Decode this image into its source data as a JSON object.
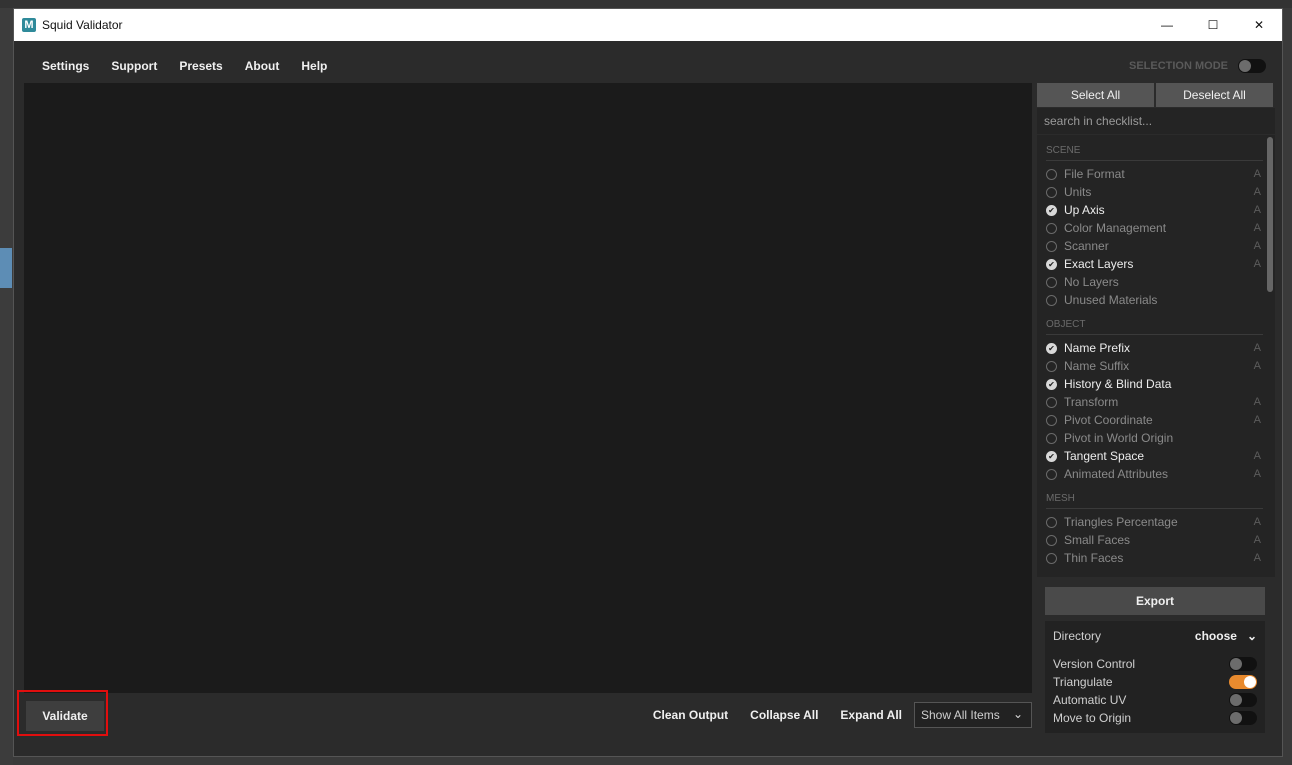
{
  "window": {
    "title": "Squid Validator",
    "icon_letter": "M"
  },
  "window_controls": {
    "minimize": "—",
    "maximize": "☐",
    "close": "✕"
  },
  "menu": {
    "items": [
      "Settings",
      "Support",
      "Presets",
      "About",
      "Help"
    ],
    "selection_mode_label": "SELECTION MODE",
    "selection_mode_on": false
  },
  "panel": {
    "select_all": "Select All",
    "deselect_all": "Deselect All",
    "search_placeholder": "search in checklist...",
    "sections": [
      {
        "title": "SCENE",
        "items": [
          {
            "label": "File Format",
            "checked": false,
            "badge": "A"
          },
          {
            "label": "Units",
            "checked": false,
            "badge": "A"
          },
          {
            "label": "Up Axis",
            "checked": true,
            "badge": "A"
          },
          {
            "label": "Color Management",
            "checked": false,
            "badge": "A"
          },
          {
            "label": "Scanner",
            "checked": false,
            "badge": "A"
          },
          {
            "label": "Exact Layers",
            "checked": true,
            "badge": "A"
          },
          {
            "label": "No Layers",
            "checked": false,
            "badge": ""
          },
          {
            "label": "Unused Materials",
            "checked": false,
            "badge": ""
          }
        ]
      },
      {
        "title": "OBJECT",
        "items": [
          {
            "label": "Name Prefix",
            "checked": true,
            "badge": "A"
          },
          {
            "label": "Name Suffix",
            "checked": false,
            "badge": "A"
          },
          {
            "label": "History & Blind Data",
            "checked": true,
            "badge": ""
          },
          {
            "label": "Transform",
            "checked": false,
            "badge": "A"
          },
          {
            "label": "Pivot Coordinate",
            "checked": false,
            "badge": "A"
          },
          {
            "label": "Pivot in World Origin",
            "checked": false,
            "badge": ""
          },
          {
            "label": "Tangent Space",
            "checked": true,
            "badge": "A"
          },
          {
            "label": "Animated Attributes",
            "checked": false,
            "badge": "A"
          }
        ]
      },
      {
        "title": "MESH",
        "items": [
          {
            "label": "Triangles Percentage",
            "checked": false,
            "badge": "A"
          },
          {
            "label": "Small Faces",
            "checked": false,
            "badge": "A"
          },
          {
            "label": "Thin Faces",
            "checked": false,
            "badge": "A"
          }
        ]
      }
    ],
    "export_label": "Export",
    "directory_label": "Directory",
    "directory_value": "choose",
    "options": [
      {
        "label": "Version Control",
        "on": false
      },
      {
        "label": "Triangulate",
        "on": true
      },
      {
        "label": "Automatic UV",
        "on": false
      },
      {
        "label": "Move to Origin",
        "on": false
      }
    ]
  },
  "bottom": {
    "validate_label": "Validate",
    "clean_output": "Clean Output",
    "collapse_all": "Collapse All",
    "expand_all": "Expand All",
    "filter_value": "Show All Items"
  },
  "colors": {
    "accent": "#e88a2e",
    "highlight": "#e10e0e"
  }
}
